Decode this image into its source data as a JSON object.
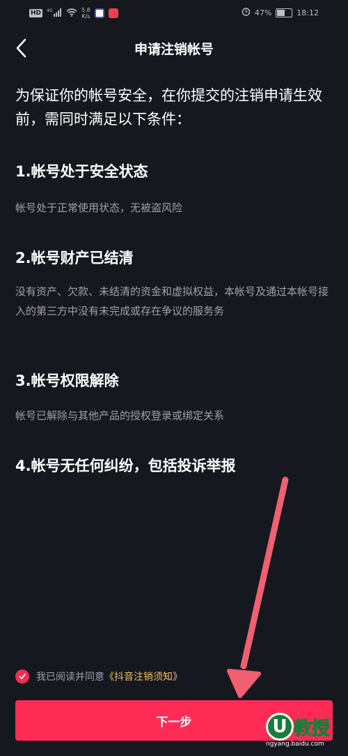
{
  "status_bar": {
    "badge": "HD",
    "network": "4G",
    "speed_value": "5.8",
    "speed_unit": "K/s",
    "battery_level": "47%",
    "battery_fraction": 0.47,
    "time": "18:12"
  },
  "nav": {
    "title": "申请注销帐号"
  },
  "intro": "为保证你的帐号安全，在你提交的注销申请生效前，需同时满足以下条件：",
  "conditions": [
    {
      "title": "1.帐号处于安全状态",
      "desc": "帐号处于正常使用状态，无被盗风险"
    },
    {
      "title": "2.帐号财产已结清",
      "desc": "没有资产、欠款、未结清的资金和虚拟权益，本帐号及通过本帐号接入的第三方中没有未完成或存在争议的服务务"
    },
    {
      "title": "3.帐号权限解除",
      "desc": "帐号已解除与其他产品的授权登录或绑定关系"
    },
    {
      "title": "4.帐号无任何纠纷，包括投诉举报"
    }
  ],
  "agreement": {
    "prefix": "我已阅读并同意",
    "link": "《抖音注销须知》"
  },
  "next_button": {
    "label": "下一步"
  },
  "watermark": {
    "logo": "U",
    "text": "教授",
    "url": "ngyang.baidu.com"
  },
  "colors": {
    "background": "#16181f",
    "accent": "#fe2c55",
    "link": "#f4c15e",
    "arrow": "#f06070"
  }
}
